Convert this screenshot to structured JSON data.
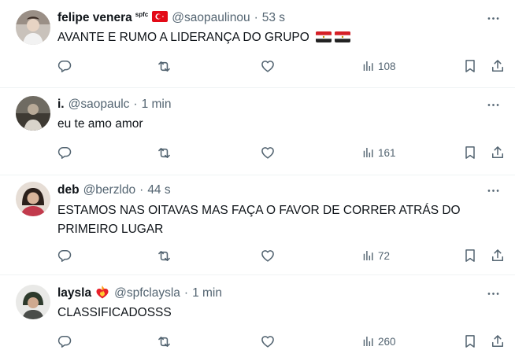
{
  "tweets": [
    {
      "name": "felipe venera",
      "badge": "spfc",
      "handle": "@saopaulinou",
      "time": "53 s",
      "text": "AVANTE E RUMO A LIDERANÇA DO GRUPO",
      "views": "108"
    },
    {
      "name": "i.",
      "handle": "@saopaulc",
      "time": "1 min",
      "text": "eu te amo amor",
      "views": "161"
    },
    {
      "name": "deb",
      "handle": "@berzldo",
      "time": "44 s",
      "text_line1": "ESTAMOS NAS OITAVAS MAS FAÇA O FAVOR DE CORRER ATRÁS DO",
      "text_line2": "PRIMEIRO LUGAR",
      "views": "72"
    },
    {
      "name": "laysla",
      "handle": "@spfclaysla",
      "time": "1 min",
      "text": "CLASSIFICADOSSS",
      "views": "260"
    }
  ],
  "separator": "·",
  "colors": {
    "text": "#0f1419",
    "secondary": "#536471",
    "border": "#eff3f4"
  }
}
